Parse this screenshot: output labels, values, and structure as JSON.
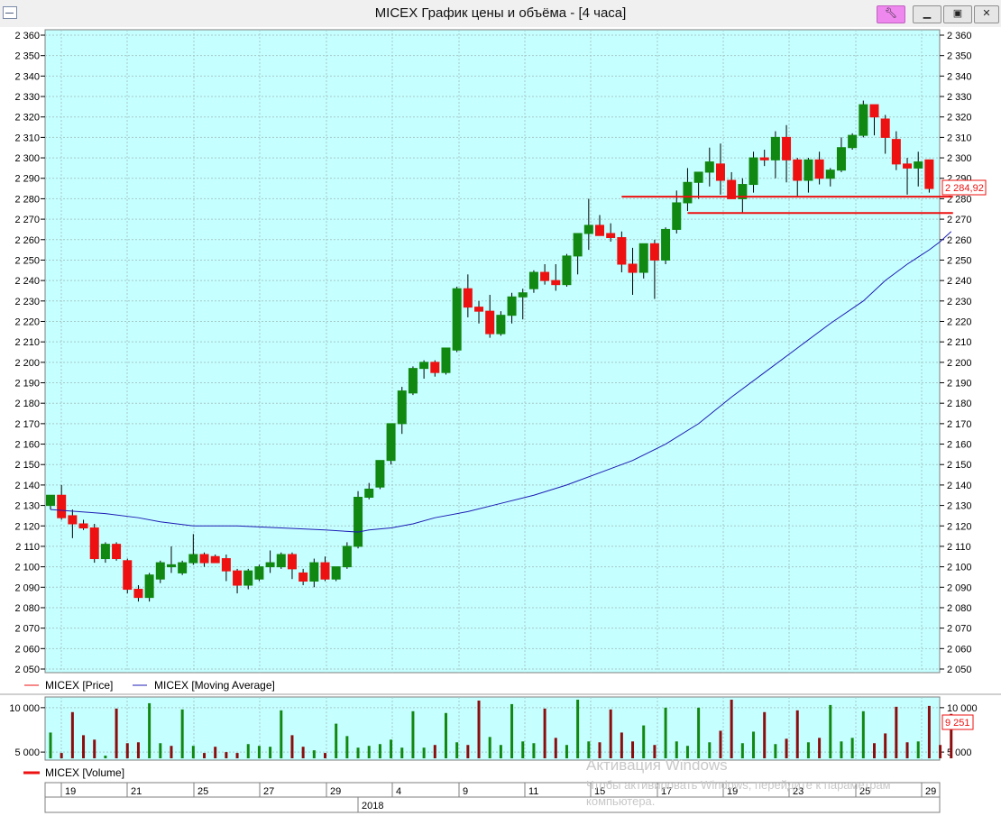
{
  "window": {
    "title": "MICEX График цены и объёма - [4 часа]",
    "pin_icon": "pin-icon",
    "minimize_icon": "minimize-icon",
    "maximize_icon": "maximize-icon",
    "close_icon": "close-icon"
  },
  "legend": {
    "price": "MICEX [Price]",
    "moving_average": "MICEX [Moving Average]",
    "volume": "MICEX [Volume]"
  },
  "price_badge": "2 284,92",
  "volume_badge": "9 251",
  "watermark": {
    "line1": "Активация Windows",
    "line2": "Чтобы активировать Windows, перейдите к параметрам",
    "line3": "компьютера."
  },
  "colors": {
    "background": "#c6ffff",
    "up": "#118811",
    "down": "#ee1111",
    "ma": "#1c1cb4",
    "level": "#ee1111"
  },
  "chart_data": [
    {
      "type": "candlestick",
      "ylim": [
        2050,
        2360
      ],
      "yticks": [
        "2 050",
        "2 060",
        "2 070",
        "2 080",
        "2 090",
        "2 100",
        "2 110",
        "2 120",
        "2 130",
        "2 140",
        "2 150",
        "2 160",
        "2 170",
        "2 180",
        "2 190",
        "2 200",
        "2 210",
        "2 220",
        "2 230",
        "2 240",
        "2 250",
        "2 260",
        "2 270",
        "2 280",
        "2 290",
        "2 300",
        "2 310",
        "2 320",
        "2 330",
        "2 340",
        "2 350",
        "2 360"
      ],
      "grid": true,
      "legend": "bottom-left",
      "series_names": [
        "MICEX [Price]",
        "MICEX [Moving Average]"
      ],
      "candles": [
        [
          2130,
          2135,
          2128,
          2135
        ],
        [
          2135,
          2140,
          2123,
          2124
        ],
        [
          2125,
          2128,
          2114,
          2121
        ],
        [
          2121,
          2123,
          2118,
          2119
        ],
        [
          2119,
          2121,
          2102,
          2104
        ],
        [
          2104,
          2112,
          2102,
          2111
        ],
        [
          2111,
          2112,
          2103,
          2104
        ],
        [
          2103,
          2104,
          2087,
          2089
        ],
        [
          2089,
          2091,
          2083,
          2085
        ],
        [
          2085,
          2097,
          2083,
          2096
        ],
        [
          2094,
          2103,
          2092,
          2102
        ],
        [
          2100,
          2110,
          2097,
          2101
        ],
        [
          2097,
          2103,
          2096,
          2102
        ],
        [
          2102,
          2116,
          2101,
          2106
        ],
        [
          2106,
          2107,
          2100,
          2102
        ],
        [
          2105,
          2106,
          2102,
          2102
        ],
        [
          2104,
          2106,
          2093,
          2098
        ],
        [
          2098,
          2099,
          2087,
          2091
        ],
        [
          2091,
          2099,
          2089,
          2098
        ],
        [
          2094,
          2101,
          2093,
          2100
        ],
        [
          2100,
          2108,
          2097,
          2102
        ],
        [
          2100,
          2107,
          2099,
          2106
        ],
        [
          2106,
          2107,
          2094,
          2099
        ],
        [
          2097,
          2099,
          2091,
          2093
        ],
        [
          2093,
          2104,
          2090,
          2102
        ],
        [
          2102,
          2105,
          2093,
          2094
        ],
        [
          2094,
          2100,
          2093,
          2100
        ],
        [
          2100,
          2112,
          2099,
          2110
        ],
        [
          2110,
          2137,
          2109,
          2134
        ],
        [
          2134,
          2141,
          2133,
          2138
        ],
        [
          2139,
          2152,
          2138,
          2152
        ],
        [
          2152,
          2170,
          2150,
          2170
        ],
        [
          2170,
          2188,
          2165,
          2186
        ],
        [
          2185,
          2198,
          2184,
          2197
        ],
        [
          2197,
          2201,
          2192,
          2200
        ],
        [
          2200,
          2201,
          2193,
          2195
        ],
        [
          2195,
          2207,
          2194,
          2207
        ],
        [
          2206,
          2237,
          2205,
          2236
        ],
        [
          2236,
          2243,
          2222,
          2227
        ],
        [
          2227,
          2230,
          2219,
          2225
        ],
        [
          2225,
          2233,
          2212,
          2214
        ],
        [
          2214,
          2225,
          2213,
          2223
        ],
        [
          2223,
          2234,
          2219,
          2232
        ],
        [
          2232,
          2236,
          2221,
          2234
        ],
        [
          2236,
          2245,
          2234,
          2244
        ],
        [
          2244,
          2248,
          2238,
          2240
        ],
        [
          2240,
          2248,
          2235,
          2238
        ],
        [
          2238,
          2253,
          2237,
          2252
        ],
        [
          2252,
          2263,
          2243,
          2263
        ],
        [
          2263,
          2280,
          2255,
          2267
        ],
        [
          2267,
          2272,
          2262,
          2262
        ],
        [
          2263,
          2268,
          2259,
          2261
        ],
        [
          2261,
          2264,
          2244,
          2248
        ],
        [
          2248,
          2256,
          2233,
          2244
        ],
        [
          2244,
          2258,
          2241,
          2258
        ],
        [
          2258,
          2260,
          2231,
          2250
        ],
        [
          2250,
          2266,
          2248,
          2265
        ],
        [
          2265,
          2284,
          2263,
          2278
        ],
        [
          2278,
          2295,
          2274,
          2288
        ],
        [
          2288,
          2292,
          2280,
          2293
        ],
        [
          2293,
          2305,
          2286,
          2298
        ],
        [
          2297,
          2307,
          2282,
          2289
        ],
        [
          2289,
          2293,
          2281,
          2280
        ],
        [
          2280,
          2290,
          2273,
          2287
        ],
        [
          2287,
          2303,
          2283,
          2300
        ],
        [
          2300,
          2304,
          2296,
          2299
        ],
        [
          2299,
          2313,
          2290,
          2310
        ],
        [
          2310,
          2316,
          2288,
          2299
        ],
        [
          2299,
          2300,
          2281,
          2289
        ],
        [
          2289,
          2300,
          2283,
          2299
        ],
        [
          2299,
          2303,
          2287,
          2290
        ],
        [
          2290,
          2295,
          2286,
          2294
        ],
        [
          2294,
          2310,
          2293,
          2305
        ],
        [
          2305,
          2312,
          2304,
          2311
        ],
        [
          2311,
          2328,
          2310,
          2326
        ],
        [
          2326,
          2326,
          2311,
          2320
        ],
        [
          2319,
          2321,
          2302,
          2310
        ],
        [
          2309,
          2313,
          2294,
          2297
        ],
        [
          2297,
          2300,
          2282,
          2295
        ],
        [
          2295,
          2303,
          2286,
          2298
        ],
        [
          2299,
          2299,
          2283,
          2285
        ]
      ],
      "moving_average": [
        [
          0,
          2128
        ],
        [
          5,
          2126
        ],
        [
          8,
          2124
        ],
        [
          10,
          2122
        ],
        [
          13,
          2120
        ],
        [
          17,
          2120
        ],
        [
          21,
          2119
        ],
        [
          25,
          2118
        ],
        [
          28,
          2117
        ],
        [
          29,
          2118
        ],
        [
          31,
          2119
        ],
        [
          33,
          2121
        ],
        [
          35,
          2124
        ],
        [
          38,
          2127
        ],
        [
          41,
          2131
        ],
        [
          44,
          2135
        ],
        [
          47,
          2140
        ],
        [
          50,
          2146
        ],
        [
          53,
          2152
        ],
        [
          56,
          2160
        ],
        [
          59,
          2170
        ],
        [
          62,
          2183
        ],
        [
          65,
          2195
        ],
        [
          68,
          2207
        ],
        [
          71,
          2219
        ],
        [
          74,
          2230
        ],
        [
          76,
          2240
        ],
        [
          78,
          2248
        ],
        [
          80,
          2255
        ],
        [
          81,
          2259
        ],
        [
          82,
          2264
        ]
      ],
      "levels": [
        {
          "value": 2281,
          "from_candle": 52,
          "to_candle": 82
        },
        {
          "value": 2273,
          "from_candle": 58,
          "to_candle": 82
        }
      ]
    },
    {
      "type": "bar",
      "ylim": [
        4300,
        11000
      ],
      "yticks": [
        "5 000",
        "10 000"
      ],
      "series_names": [
        "MICEX [Volume]"
      ],
      "values": [
        7200,
        4900,
        9500,
        6900,
        6400,
        4600,
        9900,
        6000,
        6100,
        10500,
        6000,
        5700,
        9800,
        5700,
        4900,
        5600,
        5000,
        4900,
        5900,
        5700,
        5600,
        9700,
        6900,
        5600,
        5200,
        4900,
        8200,
        6800,
        5500,
        5700,
        5900,
        6400,
        5500,
        9600,
        5500,
        5800,
        9400,
        6100,
        5800,
        10800,
        6700,
        5800,
        10400,
        6200,
        6000,
        9900,
        6600,
        5800,
        10900,
        6200,
        6100,
        9800,
        7200,
        6200,
        8000,
        5800,
        10000,
        6200,
        5700,
        10000,
        6100,
        7400,
        10900,
        6000,
        7300,
        9500,
        5900,
        6500,
        9700,
        6100,
        6600,
        10300,
        6200,
        6600,
        9600,
        6000,
        7100,
        10100,
        6100,
        6200,
        10200,
        5800,
        9300
      ],
      "up": [
        true,
        false,
        false,
        false,
        false,
        true,
        false,
        false,
        false,
        true,
        true,
        false,
        true,
        true,
        false,
        false,
        false,
        false,
        true,
        true,
        true,
        true,
        false,
        false,
        true,
        false,
        true,
        true,
        true,
        true,
        true,
        true,
        true,
        true,
        true,
        false,
        true,
        true,
        false,
        false,
        true,
        true,
        true,
        true,
        true,
        false,
        false,
        true,
        true,
        true,
        false,
        false,
        false,
        false,
        true,
        false,
        true,
        true,
        true,
        true,
        true,
        false,
        false,
        true,
        true,
        false,
        true,
        false,
        false,
        true,
        false,
        true,
        true,
        true,
        true,
        false,
        false,
        false,
        false,
        true,
        false,
        false,
        false
      ]
    }
  ],
  "time_axis": {
    "labels": [
      "19",
      "21",
      "25",
      "27",
      "29",
      "4",
      "9",
      "11",
      "15",
      "17",
      "19",
      "23",
      "25",
      "29"
    ],
    "year_label": "2018"
  }
}
